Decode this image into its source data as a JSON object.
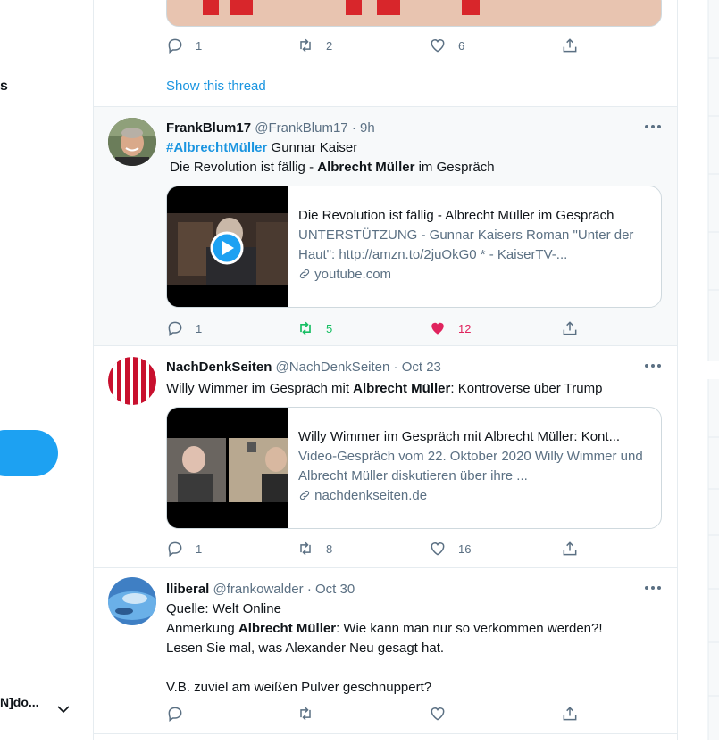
{
  "left_nav": {
    "partial_label": "s",
    "account_partial": "N]do..."
  },
  "tweets": [
    {
      "reply_count": "1",
      "retweet_count": "2",
      "like_count": "6",
      "show_thread": "Show this thread"
    },
    {
      "name": "FrankBlum17",
      "handle": "@FrankBlum17",
      "sep": "·",
      "time": "9h",
      "hashtag": "#AlbrechtMüller",
      "text1_rest": " Gunnar Kaiser",
      "text2_a": " Die Revolution ist fällig - ",
      "text2_b": "Albrecht Müller",
      "text2_c": " im Gespräch",
      "card": {
        "title": "Die Revolution ist fällig - Albrecht Müller im Gespräch",
        "desc": "UNTERSTÜTZUNG - Gunnar Kaisers Roman \"Unter der Haut\": http://amzn.to/2juOkG0 * - KaiserTV-...",
        "url": "youtube.com"
      },
      "reply_count": "1",
      "retweet_count": "5",
      "like_count": "12"
    },
    {
      "name": "NachDenkSeiten",
      "handle": "@NachDenkSeiten",
      "sep": "·",
      "time": "Oct 23",
      "text_a": "Willy Wimmer im Gespräch mit ",
      "text_b": "Albrecht Müller",
      "text_c": ": Kontroverse über Trump",
      "card": {
        "title": "Willy Wimmer im Gespräch mit Albrecht Müller: Kont...",
        "desc": "Video-Gespräch vom 22. Oktober 2020 Willy Wimmer und Albrecht Müller diskutieren über ihre ...",
        "url": "nachdenkseiten.de"
      },
      "reply_count": "1",
      "retweet_count": "8",
      "like_count": "16"
    },
    {
      "name": "lliberal",
      "handle": "@frankowalder",
      "sep": "·",
      "time": "Oct 30",
      "line1": "Quelle: Welt Online",
      "line2_a": "Anmerkung ",
      "line2_b": "Albrecht Müller",
      "line2_c": ": Wie kann man nur so verkommen werden?!",
      "line3": "Lesen Sie mal, was Alexander Neu gesagt hat.",
      "line4": "V.B. zuviel am weißen Pulver geschnuppert?"
    }
  ],
  "colors": {
    "accent": "#1da1f2",
    "link": "#1b95e0",
    "retweeted": "#17bf63",
    "liked": "#e0245e",
    "muted": "#5b7083"
  }
}
